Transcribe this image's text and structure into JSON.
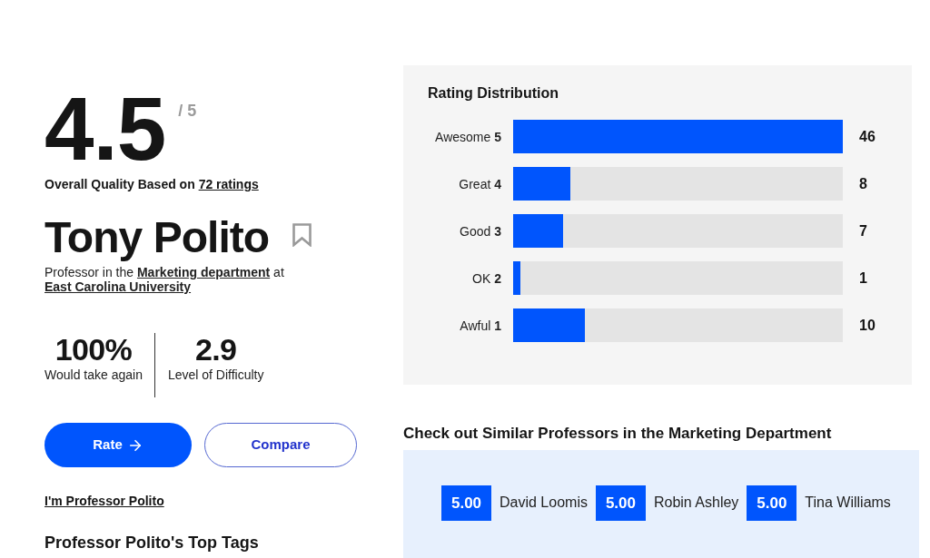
{
  "overall_rating": {
    "score": "4.5",
    "out_of": "/ 5"
  },
  "quality_caption": {
    "text": "Overall Quality Based on",
    "link": "72 ratings"
  },
  "professor": {
    "name": "Tony Polito",
    "saved": false
  },
  "affiliation": [
    {
      "kind": "text",
      "text": "Professor in the"
    },
    {
      "kind": "link",
      "text": "Marketing department"
    },
    {
      "kind": "text",
      "text": "at"
    },
    {
      "kind": "link",
      "text": "East Carolina University"
    }
  ],
  "stats": [
    {
      "value": "100%",
      "label": "Would take again"
    },
    {
      "value": "2.9",
      "label": "Level of Difficulty"
    }
  ],
  "buttons": [
    {
      "kind": "primary",
      "label": "Rate"
    },
    {
      "kind": "secondary",
      "label": "Compare"
    }
  ],
  "claim_link": "I'm Professor Polito",
  "top_tags": {
    "title": "Professor Polito's Top Tags"
  },
  "rating_distribution": {
    "title": "Rating Distribution",
    "rows": [
      {
        "label": "Awesome **5**",
        "count": "46",
        "level": 1.0
      },
      {
        "label": "Great **4**",
        "count": "8",
        "level": 0.174
      },
      {
        "label": "Good **3**",
        "count": "7",
        "level": 0.152
      },
      {
        "label": "OK **2**",
        "count": "1",
        "level": 0.022
      },
      {
        "label": "Awful **1**",
        "count": "10",
        "level": 0.217
      }
    ]
  },
  "similar_professors": {
    "title": "Check out Similar Professors in the Marketing Department",
    "items": [
      {
        "score": "5.00",
        "name": "David Loomis"
      },
      {
        "score": "5.00",
        "name": "Robin Ashley"
      },
      {
        "score": "5.00",
        "name": "Tina Williams"
      }
    ]
  }
}
